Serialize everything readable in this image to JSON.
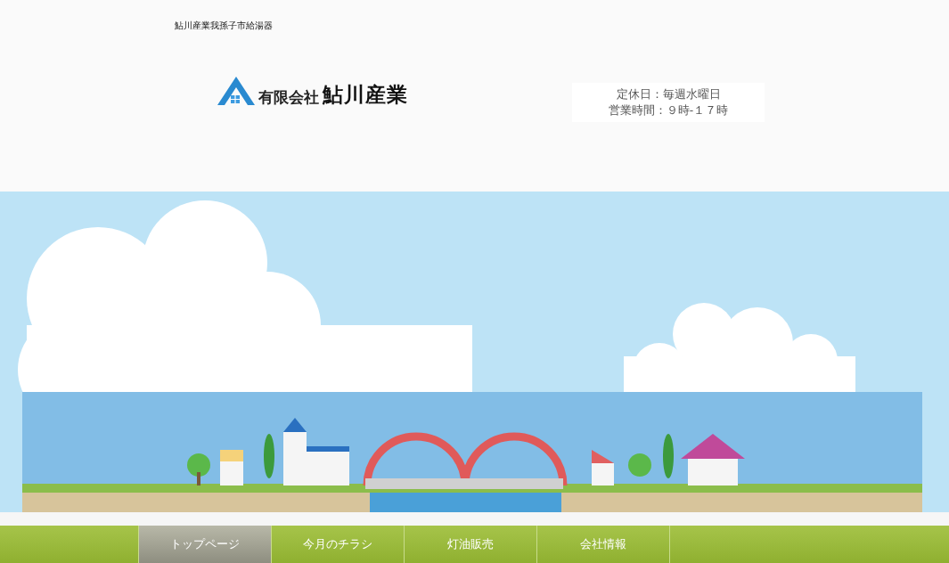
{
  "site_tagline": "鮎川産業我孫子市給湯器",
  "logo": {
    "prefix": "有限会社",
    "name": "鮎川産業"
  },
  "hours": [
    "定休日：毎週水曜日",
    "営業時間：９時-１７時"
  ],
  "nav": [
    {
      "label": "トップページ",
      "selected": true
    },
    {
      "label": "今月のチラシ",
      "selected": false
    },
    {
      "label": "灯油販売",
      "selected": false
    },
    {
      "label": "会社情報",
      "selected": false
    }
  ]
}
